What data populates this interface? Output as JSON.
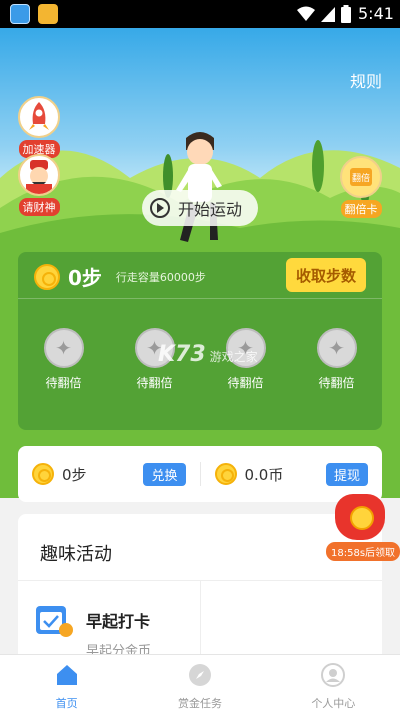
{
  "status_bar": {
    "time": "5:41"
  },
  "hero": {
    "rules": "规则",
    "left_buttons": [
      {
        "label": "加速器",
        "icon": "rocket-icon"
      },
      {
        "label": "请财神",
        "icon": "god-of-wealth-icon"
      }
    ],
    "right_button": {
      "label": "翻倍卡",
      "icon": "double-card-icon"
    },
    "start_button": "开始运动"
  },
  "steps_card": {
    "steps": "0步",
    "capacity": "行走容量60000步",
    "collect_button": "收取步数",
    "slots": [
      "待翻倍",
      "待翻倍",
      "待翻倍",
      "待翻倍"
    ],
    "watermark_logo": "K73",
    "watermark_text": "游戏之家"
  },
  "balance": {
    "steps": "0步",
    "exchange_button": "兑换",
    "coins": "0.0币",
    "withdraw_button": "提现"
  },
  "fun_activity": {
    "title": "趣味活动",
    "item_title": "早起打卡",
    "item_subtitle": "早起分金币"
  },
  "floating_reward": {
    "timer": "18:58s后领取"
  },
  "bottom_nav": [
    {
      "label": "首页",
      "active": true
    },
    {
      "label": "赏金任务",
      "active": false
    },
    {
      "label": "个人中心",
      "active": false
    }
  ],
  "colors": {
    "accent": "#3d8ff0",
    "collect": "#ffd93d",
    "grass": "#79c544",
    "sky": "#37a9e8"
  }
}
